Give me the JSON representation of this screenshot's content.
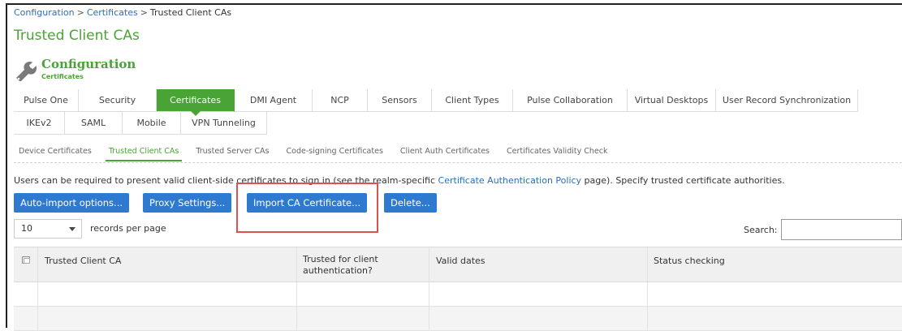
{
  "breadcrumb": {
    "items": [
      "Configuration",
      "Certificates",
      "Trusted Client CAs"
    ],
    "separator": ">"
  },
  "page_title": "Trusted Client CAs",
  "config_header": {
    "title": "Configuration",
    "subtitle": "Certificates",
    "icon": "wrench-icon"
  },
  "tabs_row1": [
    "Pulse One",
    "Security",
    "Certificates",
    "DMI Agent",
    "NCP",
    "Sensors",
    "Client Types",
    "Pulse Collaboration",
    "Virtual Desktops",
    "User Record Synchronization"
  ],
  "tabs_row2": [
    "IKEv2",
    "SAML",
    "Mobile",
    "VPN Tunneling"
  ],
  "active_tab": "Certificates",
  "subtabs": [
    "Device Certificates",
    "Trusted Client CAs",
    "Trusted Server CAs",
    "Code-signing Certificates",
    "Client Auth Certificates",
    "Certificates Validity Check"
  ],
  "active_subtab": "Trusted Client CAs",
  "intro": {
    "before": "Users can be required to present valid client-side certificates to sign in (see the realm-specific ",
    "link": "Certificate Authentication Policy",
    "after": " page). Specify trusted certificate authorities."
  },
  "buttons": {
    "auto_import": "Auto-import options...",
    "proxy_settings": "Proxy Settings...",
    "import_ca": "Import CA Certificate...",
    "delete": "Delete..."
  },
  "records": {
    "value": "10",
    "label": "records per page"
  },
  "search": {
    "label": "Search:",
    "value": ""
  },
  "table": {
    "columns": [
      "Trusted Client CA",
      "Trusted for client authentication?",
      "Valid dates",
      "Status checking"
    ],
    "column_line1": "Trusted for client",
    "column_line2": "authentication?",
    "rows": [
      [],
      []
    ]
  },
  "colors": {
    "accent_green": "#4aa336",
    "button_blue": "#2e7ad1",
    "link_blue": "#2a6ebb",
    "highlight_red": "#d9534f"
  }
}
